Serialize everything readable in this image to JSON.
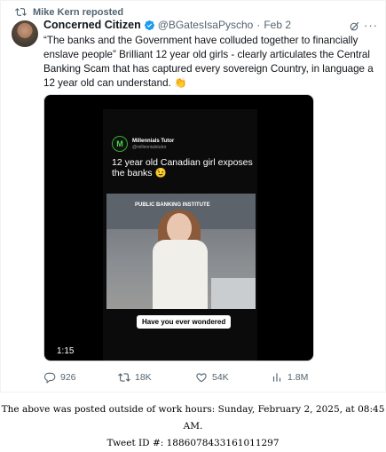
{
  "repost": {
    "label": "Mike Kern reposted"
  },
  "tweet": {
    "name": "Concerned Citizen",
    "handle": "@BGatesIsaPyscho",
    "dot": "·",
    "date": "Feb 2",
    "more": "···",
    "text": "“The banks and the Government have colluded together to financially enslave people” Brilliant 12 year old girls - clearly articulates the Central Banking Scam that has captured every sovereign Country, in language a 12 year old can understand. 👏"
  },
  "video": {
    "channel_name": "Millennials Tutor",
    "channel_sub": "@millennialstutor",
    "channel_initial": "M",
    "caption": "12 year old Canadian girl exposes the banks 😉",
    "backdrop_text": "PUBLIC BANKING INSTITUTE",
    "subtitle": "Have you ever wondered",
    "duration": "1:15"
  },
  "actions": {
    "replies": "926",
    "reposts": "18K",
    "likes": "54K",
    "views": "1.8M"
  },
  "footer": {
    "line1": "The above was posted outside of work hours: Sunday, February 2, 2025, at 08:45 AM.",
    "line2": "Tweet ID #: 1886078433161011297"
  },
  "colors": {
    "accent": "#1d9bf0",
    "muted": "#536471",
    "text": "#0f1419"
  }
}
